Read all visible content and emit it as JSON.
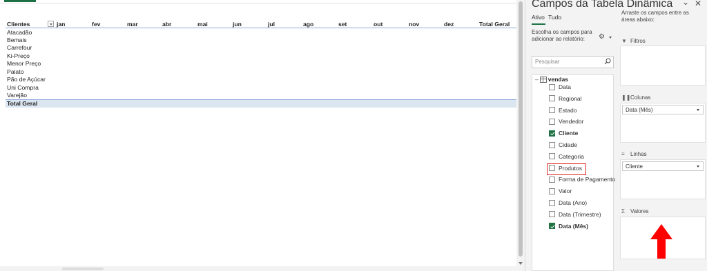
{
  "pivot": {
    "row_header": "Clientes",
    "months": [
      "jan",
      "fev",
      "mar",
      "abr",
      "mai",
      "jun",
      "jul",
      "ago",
      "set",
      "out",
      "nov",
      "dez"
    ],
    "total_col": "Total Geral",
    "rows": [
      "Atacadão",
      "Bemais",
      "Carrefour",
      "Ki-Preço",
      "Menor Preço",
      "Palato",
      "Pão de Açúcar",
      "Uni Compra",
      "Varejão"
    ],
    "total_row": "Total Geral"
  },
  "pane": {
    "title": "Campos da Tabela Dinâmica",
    "tabs": {
      "active": "Ativo",
      "all": "Tudo"
    },
    "choose_text": "Escolha os campos para adicionar ao relatório:",
    "search_placeholder": "Pesquisar",
    "table_name": "vendas",
    "fields": [
      {
        "label": "Data",
        "checked": false
      },
      {
        "label": "Regional",
        "checked": false
      },
      {
        "label": "Estado",
        "checked": false
      },
      {
        "label": "Vendedor",
        "checked": false
      },
      {
        "label": "Cliente",
        "checked": true
      },
      {
        "label": "Cidade",
        "checked": false
      },
      {
        "label": "Categoria",
        "checked": false
      },
      {
        "label": "Produtos",
        "checked": false
      },
      {
        "label": "Forma de Pagamento",
        "checked": false
      },
      {
        "label": "Valor",
        "checked": false
      },
      {
        "label": "Data (Ano)",
        "checked": false
      },
      {
        "label": "Data (Trimestre)",
        "checked": false
      },
      {
        "label": "Data (Mês)",
        "checked": true
      }
    ],
    "drag_hint": "Arraste os campos entre as áreas abaixo:",
    "areas": {
      "filters": {
        "label": "Filtros",
        "icon": "filter-icon"
      },
      "columns": {
        "label": "Colunas",
        "icon": "columns-icon",
        "chip": "Data (Mês)"
      },
      "rows": {
        "label": "Linhas",
        "icon": "rows-icon",
        "chip": "Cliente"
      },
      "values": {
        "label": "Valores",
        "icon": "sigma-icon"
      }
    }
  },
  "colors": {
    "accent": "#217346",
    "highlight": "#e02020",
    "total_fill": "#dce6f1"
  }
}
